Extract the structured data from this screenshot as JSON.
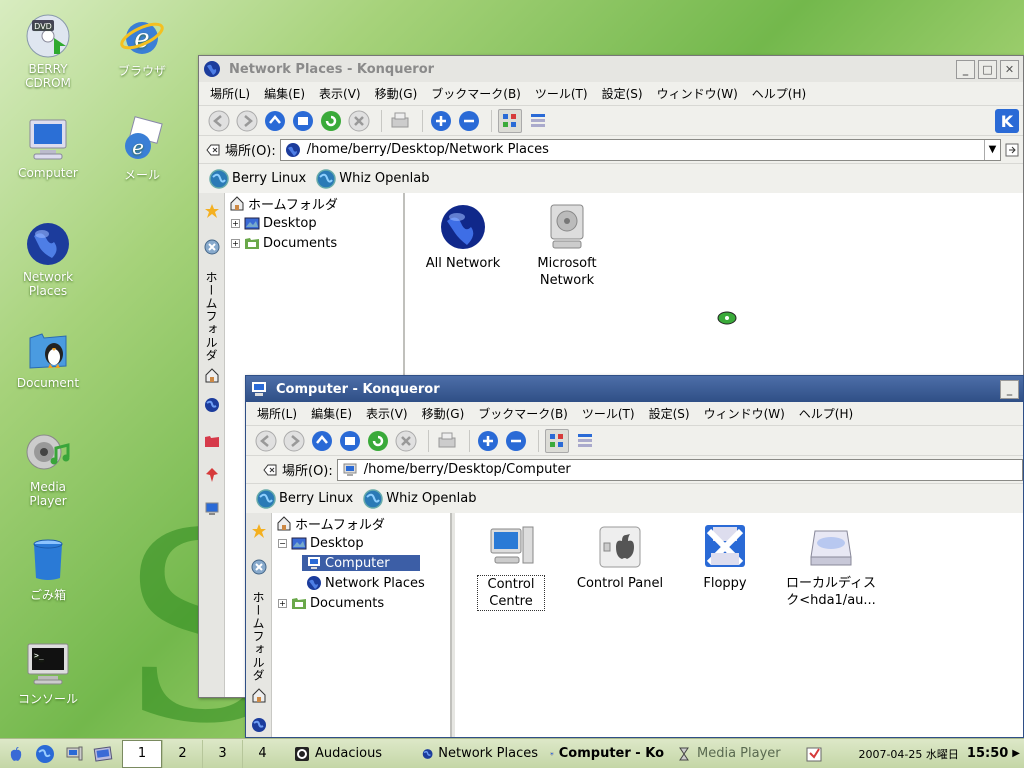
{
  "desktop": {
    "icons": [
      {
        "label": "BERRY\nCDROM",
        "icon": "dvd-icon"
      },
      {
        "label": "ブラウザ",
        "icon": "browser-icon"
      },
      {
        "label": "Computer",
        "icon": "computer-icon"
      },
      {
        "label": "メール",
        "icon": "mail-icon"
      },
      {
        "label": "Network\nPlaces",
        "icon": "globe-icon"
      },
      {
        "label": "Document",
        "icon": "folder-icon"
      },
      {
        "label": "Media\nPlayer",
        "icon": "media-player-icon"
      },
      {
        "label": "ごみ箱",
        "icon": "trash-icon"
      },
      {
        "label": "コンソール",
        "icon": "console-icon"
      }
    ]
  },
  "win_network": {
    "title": "Network Places - Konqueror",
    "menu": [
      "場所(L)",
      "編集(E)",
      "表示(V)",
      "移動(G)",
      "ブックマーク(B)",
      "ツール(T)",
      "設定(S)",
      "ウィンドウ(W)",
      "ヘルプ(H)"
    ],
    "location_label": "場所(O):",
    "location_value": "/home/berry/Desktop/Network Places",
    "bookmarks": [
      "Berry Linux",
      "Whiz Openlab"
    ],
    "sidebar_tab_label": "ホームフォルダ",
    "tree": [
      {
        "label": "ホームフォルダ"
      },
      {
        "label": "Desktop"
      },
      {
        "label": "Documents"
      }
    ],
    "items": [
      {
        "label": "All Network"
      },
      {
        "label": "Microsoft\nNetwork"
      }
    ]
  },
  "win_computer": {
    "title": "Computer - Konqueror",
    "menu": [
      "場所(L)",
      "編集(E)",
      "表示(V)",
      "移動(G)",
      "ブックマーク(B)",
      "ツール(T)",
      "設定(S)",
      "ウィンドウ(W)",
      "ヘルプ(H)"
    ],
    "location_label": "場所(O):",
    "location_value": "/home/berry/Desktop/Computer",
    "bookmarks": [
      "Berry Linux",
      "Whiz Openlab"
    ],
    "sidebar_tab_label": "ホームフォルダ",
    "tree": [
      {
        "label": "ホームフォルダ"
      },
      {
        "label": "Desktop"
      },
      {
        "label": "Computer"
      },
      {
        "label": "Network Places"
      },
      {
        "label": "Documents"
      }
    ],
    "items": [
      {
        "label": "Control\nCentre"
      },
      {
        "label": "Control Panel"
      },
      {
        "label": "Floppy"
      },
      {
        "label": "ローカルディス\nク<hda1/au..."
      }
    ]
  },
  "taskbar": {
    "desktops": [
      "1",
      "2",
      "3",
      "4"
    ],
    "tasks": [
      {
        "label": "Audacious",
        "state": "normal"
      },
      {
        "label": "Network Places",
        "state": "normal"
      },
      {
        "label": "Computer - Ko",
        "state": "active"
      },
      {
        "label": "Media Player",
        "state": "inactive"
      }
    ],
    "date": "2007-04-25 水曜日",
    "time": "15:50"
  },
  "colors": {
    "active_title": "#3c5ea6",
    "selection": "#3c5ea6",
    "desktop_green": "#73b84c"
  }
}
